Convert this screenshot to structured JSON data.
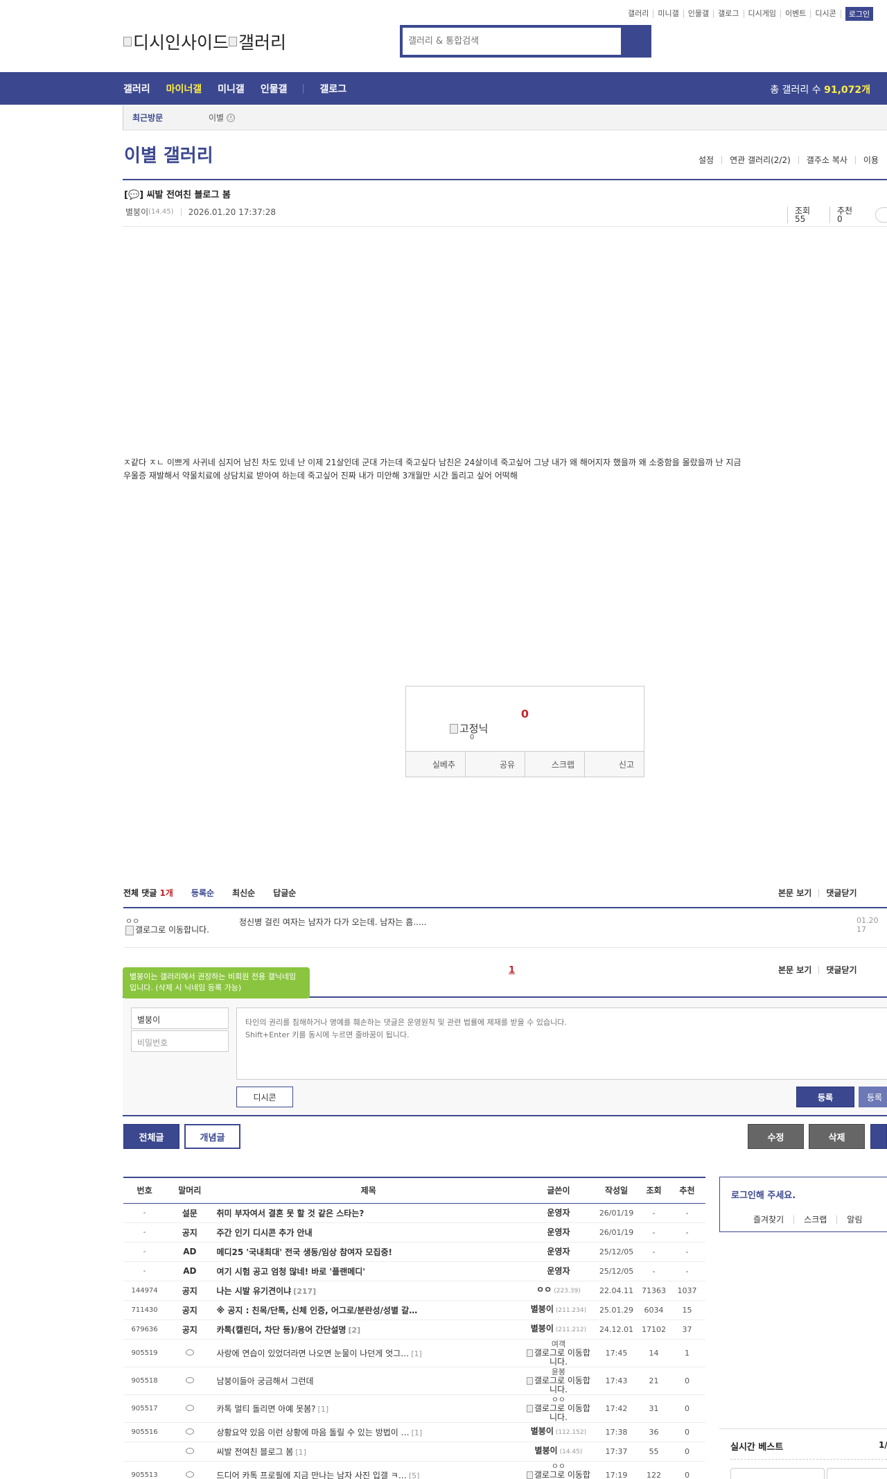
{
  "topnav": {
    "links": [
      "갤러리",
      "미니갤",
      "인물갤",
      "갤로그",
      "디시게임",
      "이벤트",
      "디시콘"
    ],
    "login": "로그인"
  },
  "logo": {
    "alt1": "디시인사이드",
    "alt2": "갤러리"
  },
  "search": {
    "placeholder": "갤러리 & 통합검색",
    "icon": "search-icon"
  },
  "gnb": {
    "items": [
      "갤러리",
      "마이너갤",
      "미니갤",
      "인물갤",
      "갤로그"
    ],
    "selected": "마이너갤",
    "total_label": "총 갤러리 수",
    "total_value": "91,072개"
  },
  "recent": {
    "label": "최근방문",
    "gallery": "이별",
    "close": "ⓧ"
  },
  "gallery": {
    "title": "이별 갤러리",
    "tools": [
      "설정",
      "연관 갤러리(2/2)",
      "갤주소 복사",
      "이용"
    ]
  },
  "post": {
    "title": "[💬] 씨발 전여친 블로그 봄",
    "author": "별붕이",
    "author_ip": "(14.45)",
    "date": "2026.01.20 17:37:28",
    "views": "조회 55",
    "recommend": "추천 0",
    "body": "ㅈ같다 ㅈㄴ 이쁘게 사귀네 심지어 남친 차도 있네 난 이제 21살인데 군대 가는데 죽고싶다 남친은 24살이네 죽고싶어 그냥 내가 왜 해어지자 했을까 왜 소중함을 몰랐을까 난 지금 우울증 재발해서 약물치료에 상담치료 받아여 하는데 죽고싶어 진짜 내가 미안해 3개월만 시간 돌리고 싶어 어떡해"
  },
  "recommend_box": {
    "count": "0",
    "fixed_nick_alt": "고정닉",
    "fixed_count": "0",
    "buttons": [
      "실베추",
      "공유",
      "스크랩",
      "신고"
    ]
  },
  "comments": {
    "total_label": "전체 댓글",
    "total_count": "1개",
    "sorts": [
      "등록순",
      "최신순",
      "답글순"
    ],
    "actions": [
      "본문 보기",
      "댓글닫기"
    ],
    "items": [
      {
        "nick": "ㅇㅇ",
        "img_alt": "갤로그로 이동합니다.",
        "text": "정신병 걸린 여자는 남자가 다가 오는데. 남자는 흠.....",
        "date": "01.20 17"
      }
    ],
    "page": "1"
  },
  "write": {
    "tooltip": "별붕이는 갤러리에서 권장하는 비회원 전용 갤닉네임입니다. (삭제 시 닉네임 등록 가능)",
    "nick": "별붕이",
    "password_placeholder": "비밀번호",
    "textarea_placeholder": "타인의 권리를 침해하거나 명예를 훼손하는 댓글은 운영원칙 및 관련 법률에 제재를 받을 수 있습니다.\nShift+Enter 키를 동시에 누르면 줄바꿈이 됩니다.",
    "dccon": "디시콘",
    "submit": "등록",
    "submit2": "등록"
  },
  "board_buttons": {
    "all": "전체글",
    "concept": "개념글",
    "edit": "수정",
    "delete": "삭제"
  },
  "list": {
    "headers": [
      "번호",
      "말머리",
      "제목",
      "글쓴이",
      "작성일",
      "조회",
      "추천"
    ],
    "rows": [
      {
        "num": "-",
        "head": "설문",
        "title": "취미 부자여서 결혼 못 할 것 같은 스타는?",
        "bold": true,
        "reply": "",
        "writer": "운영자",
        "ip": "",
        "img": false,
        "date": "26/01/19",
        "views": "-",
        "rec": "-"
      },
      {
        "num": "-",
        "head": "공지",
        "title": "주간 인기 디시콘 추가 안내",
        "bold": true,
        "reply": "",
        "writer": "운영자",
        "ip": "",
        "img": false,
        "date": "26/01/19",
        "views": "-",
        "rec": "-"
      },
      {
        "num": "-",
        "head": "AD",
        "title": "메디25 '국내최대' 전국 생동/임상 참여자 모집중!",
        "bold": true,
        "reply": "",
        "writer": "운영자",
        "ip": "",
        "img": false,
        "date": "25/12/05",
        "views": "-",
        "rec": "-"
      },
      {
        "num": "-",
        "head": "AD",
        "title": "여기 시험 공고 엄청 많네! 바로 '플랜메디'",
        "bold": true,
        "reply": "",
        "writer": "운영자",
        "ip": "",
        "img": false,
        "date": "25/12/05",
        "views": "-",
        "rec": "-"
      },
      {
        "num": "144974",
        "head": "공지",
        "title": "나는 시발 유기견이냐",
        "bold": true,
        "reply": "[217]",
        "writer": "ㅇㅇ",
        "ip": "(223.39)",
        "img": false,
        "date": "22.04.11",
        "views": "71363",
        "rec": "1037"
      },
      {
        "num": "711430",
        "head": "공지",
        "title": "※ 공지 : 친목/단톡, 신체 인증, 어그로/분란성/성별 갈…",
        "bold": true,
        "reply": "",
        "writer": "별붕이",
        "ip": "(211.234)",
        "img": false,
        "date": "25.01.29",
        "views": "6034",
        "rec": "15"
      },
      {
        "num": "679636",
        "head": "공지",
        "title": "카톡(캘린더, 차단 등)/용어 간단설명",
        "bold": true,
        "reply": "[2]",
        "writer": "별붕이",
        "ip": "(211.212)",
        "img": false,
        "date": "24.12.01",
        "views": "17102",
        "rec": "37"
      },
      {
        "num": "905519",
        "head": "💬",
        "title": "사랑에 연습이 있었더라면 나오면 눈물이 나던게 엇그…",
        "bold": false,
        "reply": "[1]",
        "writer": "여객",
        "ip": "",
        "img": true,
        "date": "17:45",
        "views": "14",
        "rec": "1"
      },
      {
        "num": "905518",
        "head": "💬",
        "title": "남붕이들아 궁금해서 그런데",
        "bold": false,
        "reply": "",
        "writer": "윤봉",
        "ip": "",
        "img": true,
        "date": "17:43",
        "views": "21",
        "rec": "0"
      },
      {
        "num": "905517",
        "head": "💬",
        "title": "카톡 멀티 돌리면 아예 못봄?",
        "bold": false,
        "reply": "[1]",
        "writer": "ㅇㅇ",
        "ip": "",
        "img": true,
        "date": "17:42",
        "views": "31",
        "rec": "0"
      },
      {
        "num": "905516",
        "head": "💬",
        "title": "상황요약 있음 이런 상황에 마음 돌릴 수 있는 방법이 …",
        "bold": false,
        "reply": "[1]",
        "writer": "별붕이",
        "ip": "(112.152)",
        "img": false,
        "date": "17:38",
        "views": "36",
        "rec": "0"
      },
      {
        "num": "",
        "head": "💬",
        "title": "씨발 전여친 블로그 봄",
        "bold": false,
        "reply": "[1]",
        "writer": "별붕이",
        "ip": "(14.45)",
        "img": false,
        "date": "17:37",
        "views": "55",
        "rec": "0"
      },
      {
        "num": "905513",
        "head": "💬",
        "title": "드디어 카톡 프로필에 지금 만나는 남자 사진 입갤 ㅋ…",
        "bold": false,
        "reply": "[5]",
        "writer": "ㅇㅇ",
        "ip": "",
        "img": true,
        "date": "17:19",
        "views": "122",
        "rec": "0"
      }
    ],
    "img_alt": "갤로그로 이동합니다."
  },
  "side": {
    "login_prompt": "로그인해 주세요.",
    "login_links": [
      "즐겨찾기",
      "스크랩",
      "알림"
    ],
    "best_title": "실시간 베스트",
    "best_page": "1/"
  },
  "colors": {
    "navy": "#3b4890",
    "yellow": "#ffed45",
    "red": "#c1272d",
    "green": "#8bc53f"
  }
}
